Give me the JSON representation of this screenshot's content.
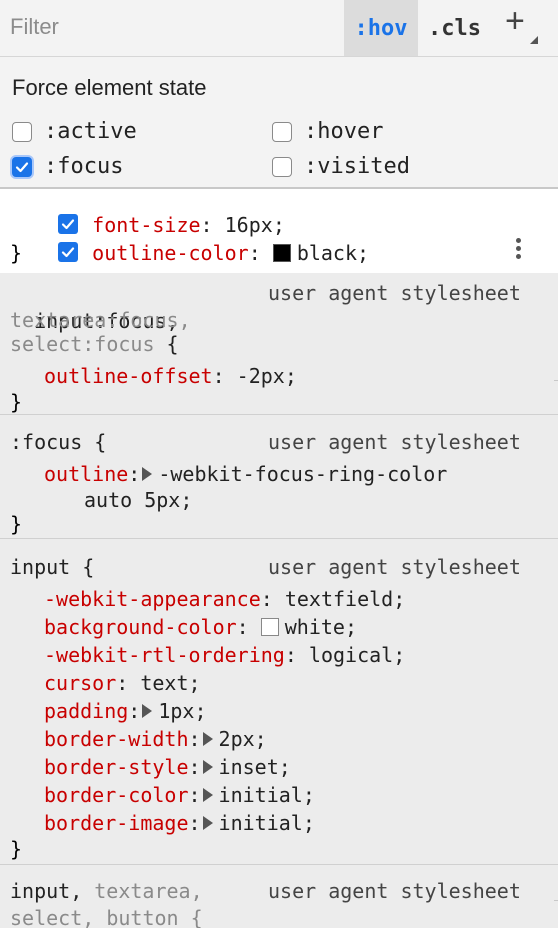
{
  "toolbar": {
    "filter_placeholder": "Filter",
    "hov_label": ":hov",
    "cls_label": ".cls",
    "add_label": "+"
  },
  "force_state": {
    "title": "Force element state",
    "states": [
      {
        "label": ":active",
        "checked": false
      },
      {
        "label": ":hover",
        "checked": false
      },
      {
        "label": ":focus",
        "checked": true
      },
      {
        "label": ":visited",
        "checked": false
      }
    ]
  },
  "rule0": {
    "decls": [
      {
        "prop": "font-size",
        "value": "16px",
        "enabled": true
      },
      {
        "prop": "outline-color",
        "value": "black",
        "enabled": true,
        "swatch": "#000000"
      }
    ],
    "close": "}"
  },
  "rules": {
    "r1": {
      "selector_main": "input:focus,",
      "selector_dim1": "textarea:focus,",
      "selector_dim2": "select:focus",
      "open": " {",
      "source": "user agent stylesheet",
      "decls": [
        {
          "prop": "outline-offset",
          "value": "-2px"
        }
      ],
      "close": "}"
    },
    "r2": {
      "selector": ":focus",
      "open": " {",
      "source": "user agent stylesheet",
      "decls": [
        {
          "prop": "outline",
          "value": "-webkit-focus-ring-color",
          "value2": "auto 5px;"
        }
      ],
      "close": "}"
    },
    "r3": {
      "selector": "input",
      "open": " {",
      "source": "user agent stylesheet",
      "decls": [
        {
          "prop": "-webkit-appearance",
          "value": "textfield"
        },
        {
          "prop": "background-color",
          "value": "white",
          "swatch": "#ffffff"
        },
        {
          "prop": "-webkit-rtl-ordering",
          "value": "logical"
        },
        {
          "prop": "cursor",
          "value": "text"
        },
        {
          "prop": "padding",
          "value": "1px",
          "expandable": true
        },
        {
          "prop": "border-width",
          "value": "2px",
          "expandable": true
        },
        {
          "prop": "border-style",
          "value": "inset",
          "expandable": true
        },
        {
          "prop": "border-color",
          "value": "initial",
          "expandable": true
        },
        {
          "prop": "border-image",
          "value": "initial",
          "expandable": true
        }
      ],
      "close": "}"
    },
    "r4": {
      "selector_main": "input,",
      "selector_dim": "textarea,",
      "selector_line2": "select, button {",
      "source": "user agent stylesheet"
    }
  },
  "colors": {
    "accent": "#1a73e8",
    "property": "#c80000",
    "panel_bg": "#f3f3f3",
    "styles_bg": "#ececec"
  }
}
